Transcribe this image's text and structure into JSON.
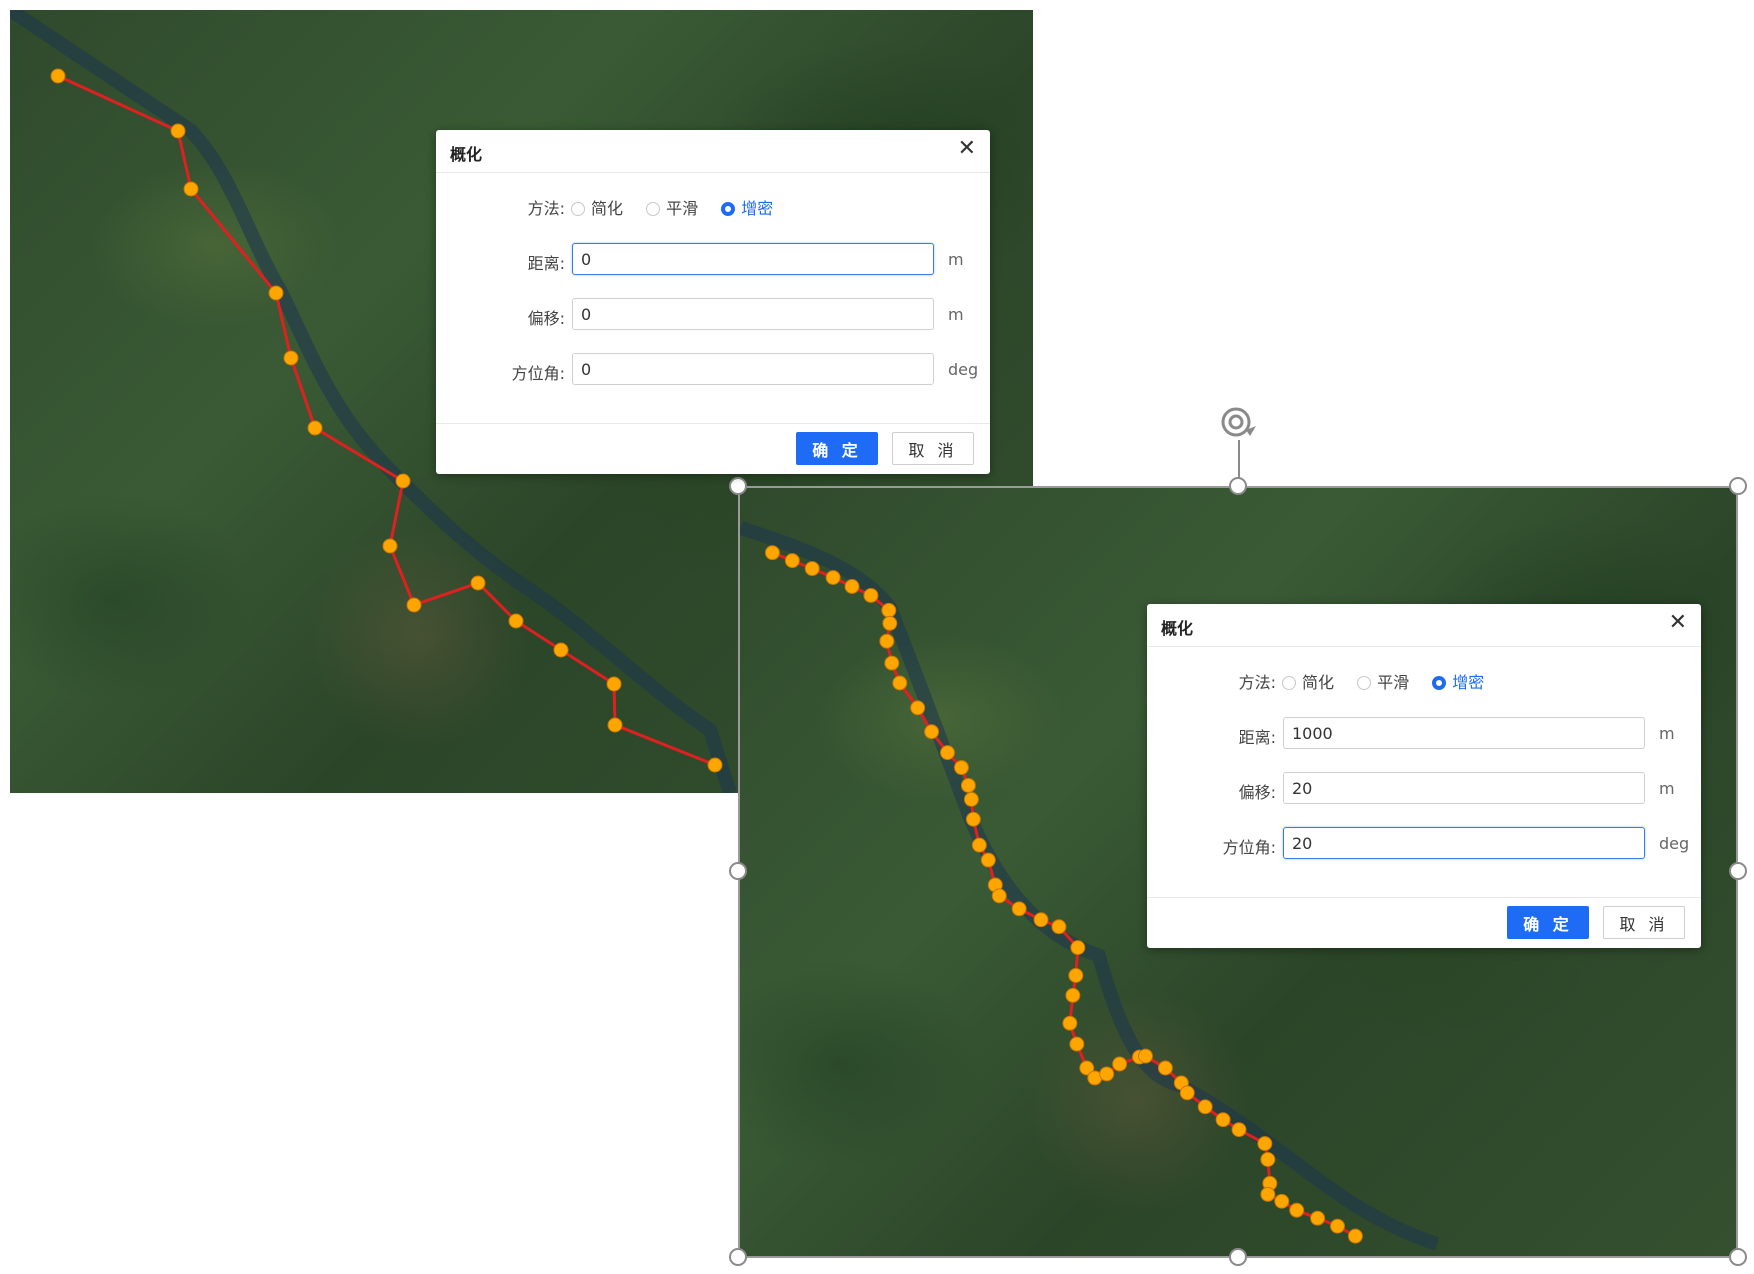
{
  "left_panel": {
    "dialog": {
      "title": "概化",
      "method_label": "方法:",
      "methods": [
        "简化",
        "平滑",
        "增密"
      ],
      "selected_method": "增密",
      "distance_label": "距离:",
      "distance_value": "0",
      "distance_unit": "m",
      "offset_label": "偏移:",
      "offset_value": "0",
      "offset_unit": "m",
      "azimuth_label": "方位角:",
      "azimuth_value": "0",
      "azimuth_unit": "deg",
      "ok_label": "确 定",
      "cancel_label": "取 消"
    }
  },
  "right_panel": {
    "dialog": {
      "title": "概化",
      "method_label": "方法:",
      "methods": [
        "简化",
        "平滑",
        "增密"
      ],
      "selected_method": "增密",
      "distance_label": "距离:",
      "distance_value": "1000",
      "distance_unit": "m",
      "offset_label": "偏移:",
      "offset_value": "20",
      "offset_unit": "m",
      "azimuth_label": "方位角:",
      "azimuth_value": "20",
      "azimuth_unit": "deg",
      "ok_label": "确 定",
      "cancel_label": "取 消"
    }
  },
  "colors": {
    "line": "#e02020",
    "vertex": "#ffa500",
    "accent": "#1e6cf5"
  },
  "icons": [
    "close-icon",
    "rotate-icon"
  ]
}
